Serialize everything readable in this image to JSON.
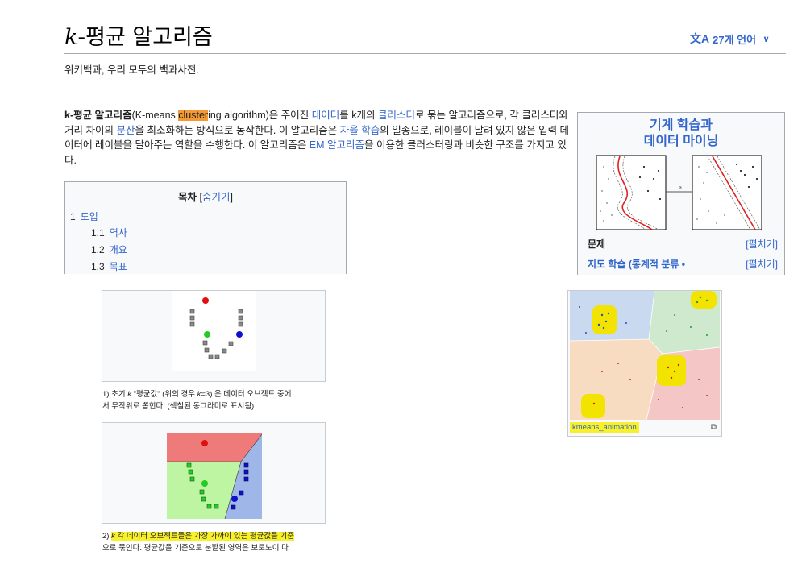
{
  "header": {
    "title_prefix": "k",
    "title_rest": "-평균 알고리즘",
    "lang_icon": "文A",
    "lang_label": "27개 언어",
    "lang_chevron": "∨",
    "tagline": "위키백과, 우리 모두의 백과사전."
  },
  "lead": {
    "term": "k-평균 알고리즘",
    "p1": "(K-means ",
    "highlight": "cluster",
    "p2": "ing algorithm)은 주어진 ",
    "link_data": "데이터",
    "p3": "를 k개의 ",
    "link_cluster": "클러스터",
    "p4": "로 묶는 알고리즘으로, 각 클러스터와 거리 차이의 ",
    "link_variance": "분산",
    "p5": "을 최소화하는 방식으로 동작한다. 이 알고리즘은 ",
    "link_unsup": "자율 학습",
    "p6": "의 일종으로, 레이블이 달려 있지 않은 입력 데이터에 레이블을 달아주는 역할을 수행한다. 이 알고리즘은 ",
    "link_em": "EM 알고리즘",
    "p7": "을 이용한 클러스터링과 비슷한 구조를 가지고 있다."
  },
  "toc": {
    "title": "목차",
    "hide_open": " [",
    "hide": "숨기기",
    "hide_close": "]",
    "items": [
      {
        "num": "1",
        "label": "도입"
      },
      {
        "num": "1.1",
        "label": "역사"
      },
      {
        "num": "1.2",
        "label": "개요"
      },
      {
        "num": "1.3",
        "label": "목표"
      }
    ]
  },
  "infobox": {
    "title_line1": "기계 학습과",
    "title_line2": "데이터 마이닝",
    "rows": [
      {
        "label": "문제",
        "action": "[펼치기]"
      },
      {
        "label": "지도 학습 (통계적 분류 •",
        "action": "[펼치기]"
      }
    ]
  },
  "figures": {
    "fig1_caption_a": "1) 초기 ",
    "fig1_caption_k": "k",
    "fig1_caption_b": " \"평균값\" (위의 경우 ",
    "fig1_caption_k2": "k",
    "fig1_caption_c": "=3) 은 데이터 오브젝트 중에",
    "fig1_caption_line2": "서 무작위로 뽑힌다. (색칠된 동그라미로 표시됨).",
    "fig2_caption_a": "2) ",
    "fig2_caption_k": "k",
    "fig2_caption_b": " 각 데이터 오브젝트들은 가장 가까이 있는 평균값을 기준",
    "fig2_caption_line2": "으로 묶인다. 평균값을 기준으로 분할된 영역은 보로노이 다",
    "kmeans_label": "kmeans_animation",
    "enlarge_icon": "⧉"
  },
  "colors": {
    "link": "#3366cc",
    "highlight_orange": "#f59a32",
    "highlight_yellow": "#f7f02b",
    "border": "#a2a9b1"
  }
}
